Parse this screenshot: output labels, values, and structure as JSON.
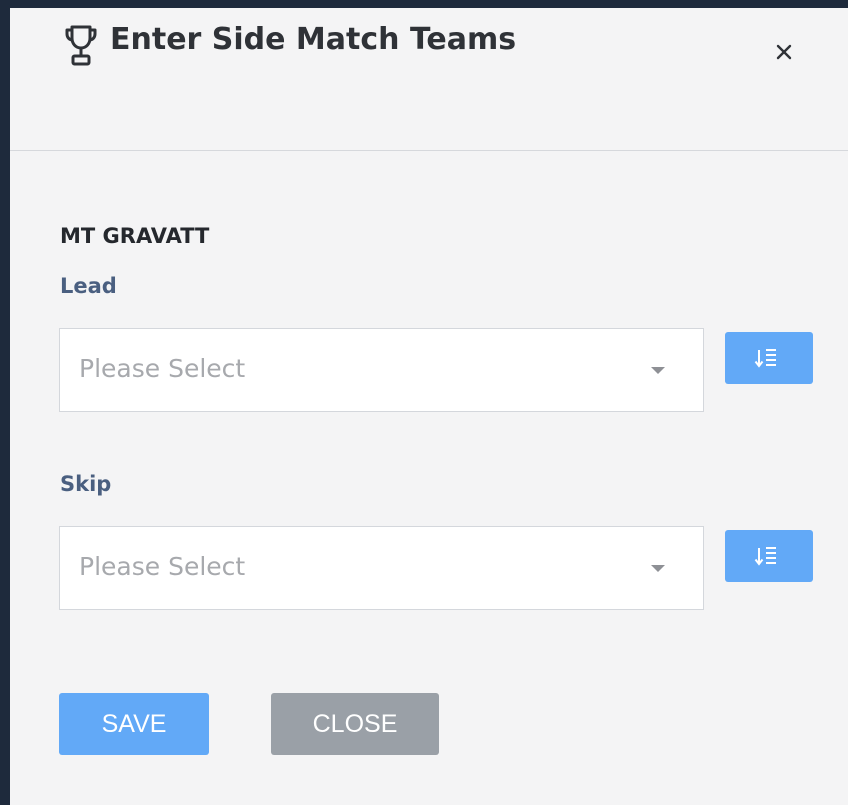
{
  "modal": {
    "title": "Enter Side Match Teams",
    "title_icon": "trophy-icon",
    "close_icon": "close-icon"
  },
  "team": {
    "name": "MT GRAVATT",
    "positions": [
      {
        "label": "Lead",
        "placeholder": "Please Select",
        "sort_icon": "sort-list-icon"
      },
      {
        "label": "Skip",
        "placeholder": "Please Select",
        "sort_icon": "sort-list-icon"
      }
    ]
  },
  "footer": {
    "save_label": "SAVE",
    "close_label": "CLOSE"
  },
  "colors": {
    "primary": "#62a9f7",
    "secondary": "#9aa0a7",
    "label": "#4a5f80",
    "background": "#f4f4f5"
  }
}
